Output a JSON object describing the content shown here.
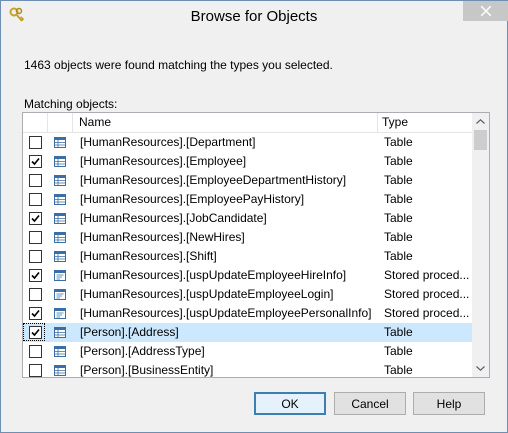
{
  "window": {
    "title": "Browse for Objects"
  },
  "dialog": {
    "summary": "1463 objects were found matching the types you selected.",
    "matching_label": "Matching objects:"
  },
  "list": {
    "columns": {
      "name": "Name",
      "type": "Type"
    },
    "rows": [
      {
        "checked": false,
        "name": "[HumanResources].[Department]",
        "type": "Table",
        "icon": "table-icon"
      },
      {
        "checked": true,
        "name": "[HumanResources].[Employee]",
        "type": "Table",
        "icon": "table-icon"
      },
      {
        "checked": false,
        "name": "[HumanResources].[EmployeeDepartmentHistory]",
        "type": "Table",
        "icon": "table-icon"
      },
      {
        "checked": false,
        "name": "[HumanResources].[EmployeePayHistory]",
        "type": "Table",
        "icon": "table-icon"
      },
      {
        "checked": true,
        "name": "[HumanResources].[JobCandidate]",
        "type": "Table",
        "icon": "table-icon"
      },
      {
        "checked": false,
        "name": "[HumanResources].[NewHires]",
        "type": "Table",
        "icon": "table-icon"
      },
      {
        "checked": false,
        "name": "[HumanResources].[Shift]",
        "type": "Table",
        "icon": "table-icon"
      },
      {
        "checked": true,
        "name": "[HumanResources].[uspUpdateEmployeeHireInfo]",
        "type": "Stored proced...",
        "icon": "stored-procedure-icon"
      },
      {
        "checked": false,
        "name": "[HumanResources].[uspUpdateEmployeeLogin]",
        "type": "Stored proced...",
        "icon": "stored-procedure-icon"
      },
      {
        "checked": true,
        "name": "[HumanResources].[uspUpdateEmployeePersonalInfo]",
        "type": "Stored proced...",
        "icon": "stored-procedure-icon"
      },
      {
        "checked": true,
        "name": "[Person].[Address]",
        "type": "Table",
        "icon": "table-icon",
        "selected": true
      },
      {
        "checked": false,
        "name": "[Person].[AddressType]",
        "type": "Table",
        "icon": "table-icon"
      },
      {
        "checked": false,
        "name": "[Person].[BusinessEntity]",
        "type": "Table",
        "icon": "table-icon"
      }
    ]
  },
  "buttons": {
    "ok": "OK",
    "cancel": "Cancel",
    "help": "Help"
  },
  "colors": {
    "selection": "#cce8ff",
    "default_button_border": "#3c7fb1",
    "close_button": "#c7c7c7"
  }
}
